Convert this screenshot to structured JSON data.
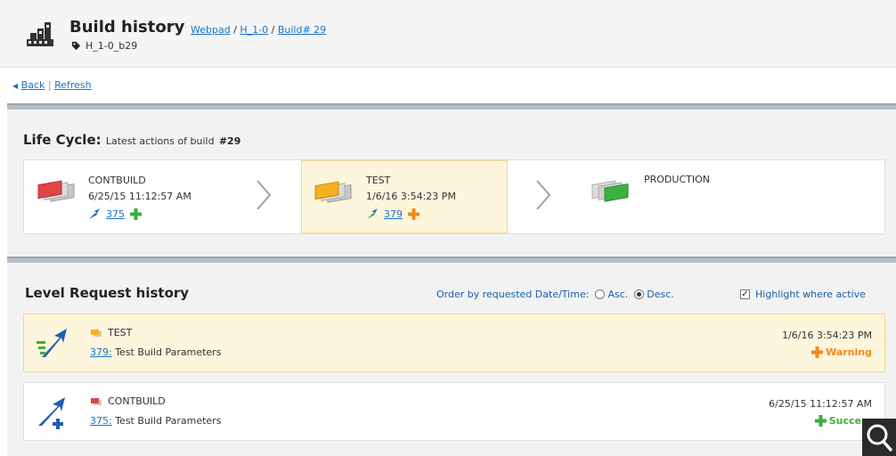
{
  "header": {
    "title": "Build history",
    "breadcrumbs": [
      "Webpad",
      "H_1-0",
      "Build# 29"
    ],
    "separator": " / ",
    "tag": "H_1-0_b29"
  },
  "actions": {
    "back": "Back",
    "refresh": "Refresh",
    "divider": "|"
  },
  "lifecycle": {
    "title": "Life Cycle:",
    "subtitle": "Latest actions of build",
    "build_ref": "#29",
    "stages": [
      {
        "name": "CONTBUILD",
        "date": "6/25/15 11:12:57 AM",
        "request": "375",
        "status": "success",
        "color": "#e04545",
        "active": false
      },
      {
        "name": "TEST",
        "date": "1/6/16 3:54:23 PM",
        "request": "379",
        "status": "warning",
        "color": "#f5b020",
        "active": true
      },
      {
        "name": "PRODUCTION",
        "date": "",
        "request": "",
        "status": "",
        "color": "#3cb043",
        "active": false
      }
    ]
  },
  "history": {
    "title": "Level Request history",
    "order_label": "Order by requested Date/Time:",
    "asc_label": "Asc.",
    "desc_label": "Desc.",
    "order_selected": "Desc.",
    "highlight_label": "Highlight where active",
    "highlight_checked": true,
    "requests": [
      {
        "level": "TEST",
        "request_id": "379:",
        "params": "Test Build Parameters",
        "date": "1/6/16 3:54:23 PM",
        "status": "Warning",
        "status_color": "#f08a1c",
        "active": true
      },
      {
        "level": "CONTBUILD",
        "request_id": "375:",
        "params": "Test Build Parameters",
        "date": "6/25/15 11:12:57 AM",
        "status": "Succe",
        "status_color": "#3cae3c",
        "active": false
      }
    ]
  },
  "colors": {
    "link": "#1a73c8",
    "active_bg": "#fdf5dc",
    "warning": "#f08a1c",
    "success": "#3cae3c"
  },
  "icons": [
    "building-icon",
    "tag-icon",
    "back-arrow-icon",
    "chevron-right-icon",
    "deploy-arrow-icon",
    "plus-icon",
    "search-icon"
  ]
}
